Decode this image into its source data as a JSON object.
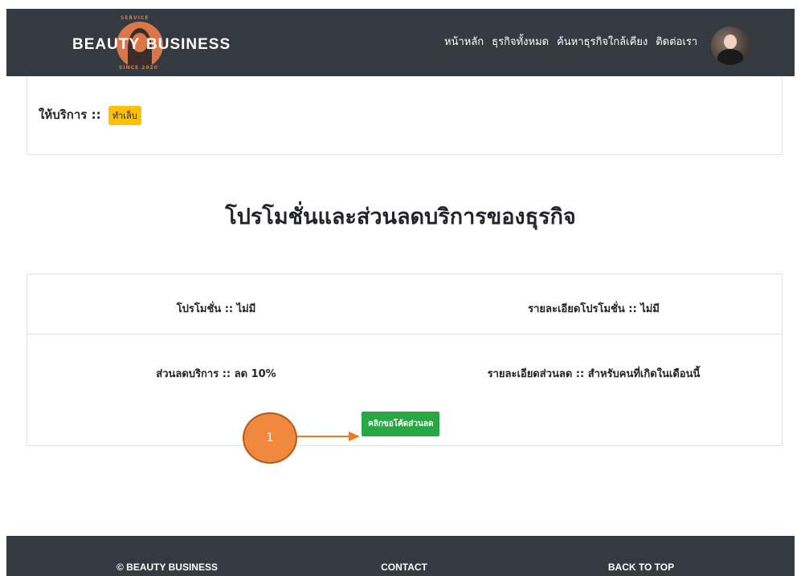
{
  "brand": {
    "top_text": "SERVICE",
    "left_word": "BEAUTY",
    "right_word": "BUSINESS",
    "since_text": "SINCE 2020",
    "accent_color": "#d9774a"
  },
  "nav": {
    "items": [
      {
        "label": "หน้าหลัก"
      },
      {
        "label": "ธุรกิจทั้งหมด"
      },
      {
        "label": "ค้นหาธุรกิจใกล้เคียง"
      },
      {
        "label": "ติดต่อเรา"
      }
    ]
  },
  "service": {
    "label": "ให้บริการ ::",
    "badge": "ทำเล็บ",
    "badge_color": "#ffc107"
  },
  "section_title": "โปรโมชั่นและส่วนลดบริการของธุรกิจ",
  "promo": {
    "promotion": "โปรโมชั่น :: ไม่มี",
    "promotion_detail": "รายละเอียดโปรโมชั่น :: ไม่มี",
    "discount": "ส่วนลดบริการ :: ลด 10%",
    "discount_detail": "รายละเอียดส่วนลด :: สำหรับคนที่เกิดในเดือนนี้",
    "coupon_button": "คลิกขอโค้ดส่วนลด",
    "button_color": "#28a745"
  },
  "annotation": {
    "marker_number": "1",
    "color": "#f0883e"
  },
  "footer": {
    "copyright": "© BEAUTY BUSINESS",
    "contact": "CONTACT",
    "back_to_top": "BACK TO TOP",
    "background": "#343a40"
  }
}
